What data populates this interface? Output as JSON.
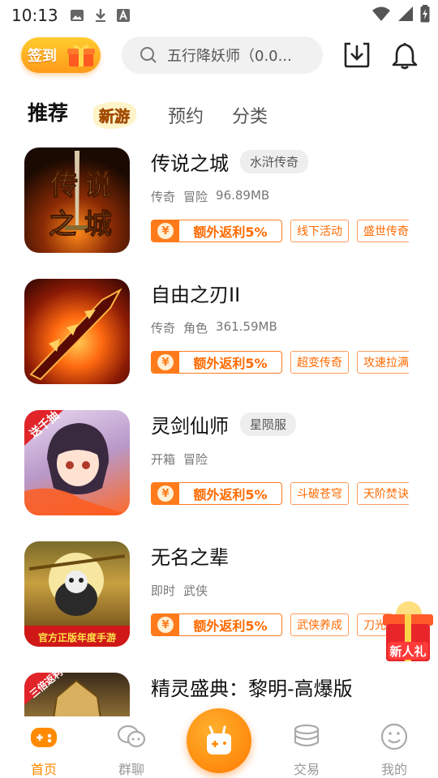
{
  "status_bar": {
    "time": "10:13"
  },
  "topbar": {
    "signin_label": "签到",
    "search_placeholder": "五行降妖师（0.0..."
  },
  "tabs": [
    {
      "label": "推荐",
      "active": true
    },
    {
      "label": "新游",
      "style": "badge"
    },
    {
      "label": "预约"
    },
    {
      "label": "分类"
    }
  ],
  "games": [
    {
      "title": "传说之城",
      "server": "水浒传奇",
      "meta": [
        "传奇",
        "冒险",
        "96.89MB"
      ],
      "rebate": "额外返利5%",
      "tags": [
        "线下活动",
        "盛世传奇"
      ],
      "thumb_text": "传说之城"
    },
    {
      "title": "自由之刃II",
      "server": "",
      "meta": [
        "传奇",
        "角色",
        "361.59MB"
      ],
      "rebate": "额外返利5%",
      "tags": [
        "超变传奇",
        "攻速拉满"
      ]
    },
    {
      "title": "灵剑仙师",
      "server": "星陨服",
      "meta": [
        "开箱",
        "冒险"
      ],
      "rebate": "额外返利5%",
      "tags": [
        "斗破苍穹",
        "天阶焚诀"
      ],
      "thumb_badge": "送千抽"
    },
    {
      "title": "无名之辈",
      "server": "",
      "meta": [
        "即时",
        "武侠"
      ],
      "rebate": "额外返利5%",
      "tags": [
        "武侠养成",
        "刀光"
      ],
      "thumb_banner": "官方正版年度手游"
    },
    {
      "title": "精灵盛典：黎明-高爆版",
      "server": "",
      "meta": [],
      "rebate": "",
      "tags": [],
      "thumb_badge": "三倍返利"
    }
  ],
  "float_gift": {
    "label": "新人礼"
  },
  "bottom_nav": [
    {
      "label": "首页",
      "icon": "gamepad-icon",
      "active": true
    },
    {
      "label": "群聊",
      "icon": "chat-icon"
    },
    {
      "label": "",
      "icon": "center-game-icon"
    },
    {
      "label": "交易",
      "icon": "coins-icon"
    },
    {
      "label": "我的",
      "icon": "smile-icon"
    }
  ],
  "colors": {
    "accent": "#ff7a1a",
    "accent_text": "#ff6a00",
    "nav_active": "#ff8a00",
    "nav_inactive": "#999999"
  }
}
